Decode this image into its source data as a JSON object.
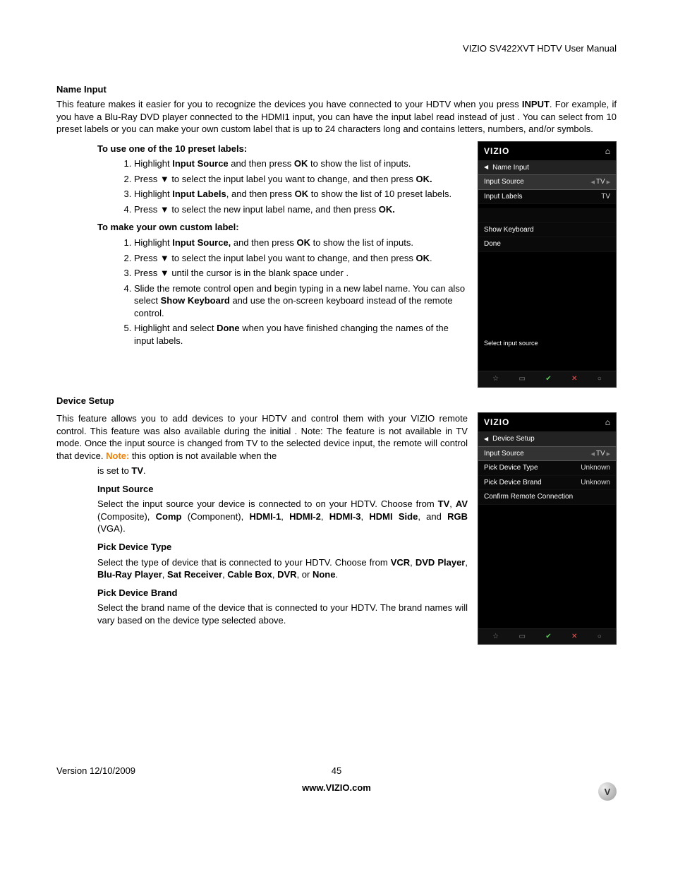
{
  "header": {
    "docTitle": "VIZIO SV422XVT HDTV User Manual"
  },
  "section1": {
    "heading": "Name Input",
    "intro_a": "This feature makes it easier for you to recognize the devices you have connected to your HDTV when you press ",
    "intro_b": "INPUT",
    "intro_c": ". For example, if you have a Blu-Ray DVD player connected to the HDMI1 input, you can have the input label read ",
    "intro_d": " instead of just ",
    "intro_e": ". You can select from 10 preset labels or you can make your own custom label that is up to 24 characters long and contains letters, numbers, and/or symbols.",
    "preset_heading": "To use one of the 10 preset labels:",
    "preset_steps": [
      "Highlight <b>Input Source</b>  and then press <b>OK</b> to show the list of inputs.",
      "Press ▼ to select the input label you want to change, and then press <b>OK.</b>",
      "Highlight <b>Input Labels</b>, and then press <b>OK</b> to show the list of 10 preset labels.",
      "Press ▼ to select the new input label name, and then press <b>OK.</b>"
    ],
    "custom_heading": "To make your own custom label:",
    "custom_steps": [
      "Highlight <b>Input Source,</b> and then press <b>OK</b> to show the list of inputs.",
      "Press ▼ to select the input label you want to change, and then press <b>OK</b>.",
      "Press ▼ until the cursor is in the blank space under .",
      "Slide the remote control open and begin typing in a new label name. You can also select <b>Show Keyboard</b> and use the on-screen keyboard instead of the remote control.",
      "Highlight and select <b>Done</b> when you have finished changing the names of the input labels."
    ]
  },
  "screenshot1": {
    "logo": "VIZIO",
    "title": "Name Input",
    "rows": [
      {
        "label": "Input Source",
        "value": "TV"
      },
      {
        "label": "Input Labels",
        "value": "TV"
      }
    ],
    "extra": [
      {
        "label": "Show Keyboard"
      },
      {
        "label": "Done"
      }
    ],
    "hint": "Select input source"
  },
  "section2": {
    "heading": "Device Setup",
    "para_a": "This feature allows you to add devices to your HDTV and control them with your VIZIO remote control. This feature was also available during the initial ",
    "para_b": ". Note: The feature is not available in TV mode. Once the input source is changed from TV to the selected device input, the remote will control that device. ",
    "note": "Note:",
    "para_c": " this option is not available when the ",
    "para_d": "is set to ",
    "para_e": "TV",
    "para_f": ".",
    "sub1": {
      "h": "Input Source",
      "p": "Select the input source your device is connected to on your HDTV. Choose from <b>TV</b>, <b>AV</b> (Composite), <b>Comp</b> (Component), <b>HDMI-1</b>, <b>HDMI-2</b>, <b>HDMI-3</b>, <b>HDMI Side</b>, and <b>RGB</b> (VGA)."
    },
    "sub2": {
      "h": "Pick Device Type",
      "p": "Select the type of device that is connected to your HDTV. Choose from <b>VCR</b>, <b>DVD Player</b>, <b>Blu-Ray Player</b>, <b>Sat Receiver</b>, <b>Cable Box</b>, <b>DVR</b>, or <b>None</b>."
    },
    "sub3": {
      "h": "Pick Device Brand",
      "p": "Select the brand name of the device that is connected to your HDTV. The brand names will vary based on the device type selected above."
    }
  },
  "screenshot2": {
    "logo": "VIZIO",
    "title": "Device Setup",
    "rows": [
      {
        "label": "Input Source",
        "value": "TV"
      },
      {
        "label": "Pick Device Type",
        "value": "Unknown"
      },
      {
        "label": "Pick Device Brand",
        "value": "Unknown"
      },
      {
        "label": "Confirm Remote Connection",
        "value": ""
      }
    ]
  },
  "footer": {
    "version": "Version 12/10/2009",
    "page": "45",
    "url": "www.VIZIO.com"
  }
}
